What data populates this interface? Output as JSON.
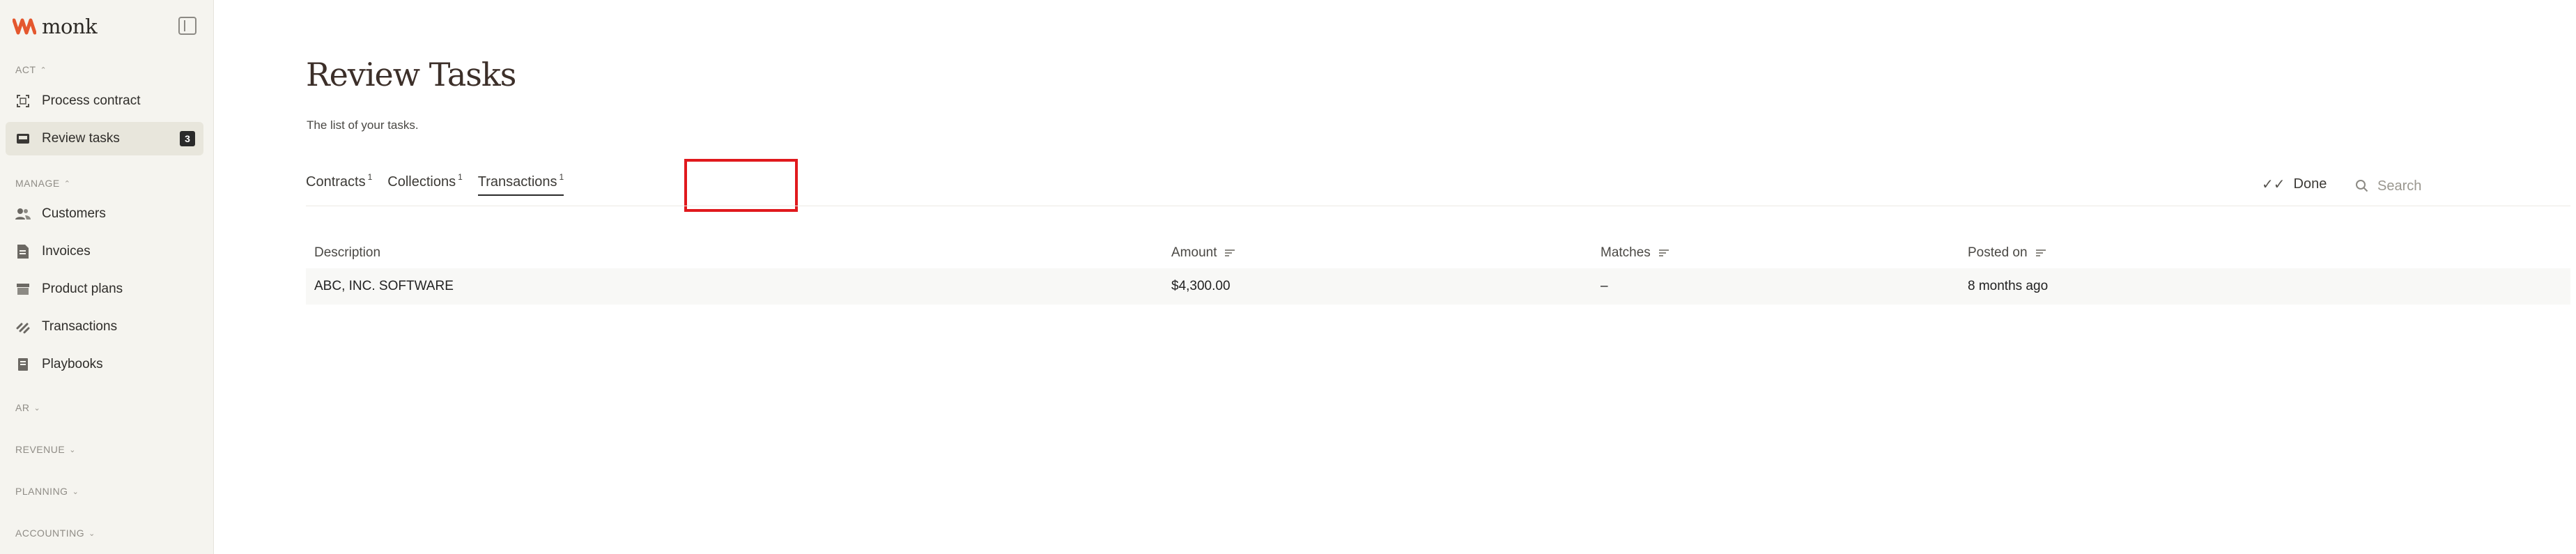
{
  "app": {
    "name": "monk"
  },
  "colors": {
    "brand": "#e4572e",
    "highlight": "#e0191d",
    "sidebar_bg": "#f5f4ef",
    "active_item_bg": "#e8e6dc"
  },
  "sidebar": {
    "sections": {
      "act": "ACT",
      "manage": "MANAGE",
      "ar": "AR",
      "revenue": "REVENUE",
      "planning": "PLANNING",
      "accounting": "ACCOUNTING"
    },
    "act_items": [
      {
        "label": "Process contract",
        "icon": "scan-document-icon"
      },
      {
        "label": "Review tasks",
        "icon": "inbox-icon",
        "badge": "3",
        "active": true
      }
    ],
    "manage_items": [
      {
        "label": "Customers",
        "icon": "users-icon"
      },
      {
        "label": "Invoices",
        "icon": "invoice-icon"
      },
      {
        "label": "Product plans",
        "icon": "box-icon"
      },
      {
        "label": "Transactions",
        "icon": "transactions-icon"
      },
      {
        "label": "Playbooks",
        "icon": "book-icon"
      }
    ]
  },
  "page": {
    "title": "Review Tasks",
    "subtitle": "The list of your tasks."
  },
  "tabs": [
    {
      "label": "Contracts",
      "count": "1"
    },
    {
      "label": "Collections",
      "count": "1"
    },
    {
      "label": "Transactions",
      "count": "1",
      "active": true
    }
  ],
  "toolbar": {
    "done_label": "Done",
    "search_placeholder": "Search"
  },
  "table": {
    "columns": [
      "Description",
      "Amount",
      "Matches",
      "Posted on"
    ],
    "rows": [
      {
        "description": "ABC, INC. SOFTWARE",
        "amount": "$4,300.00",
        "matches": "–",
        "posted_on": "8 months ago"
      }
    ]
  }
}
